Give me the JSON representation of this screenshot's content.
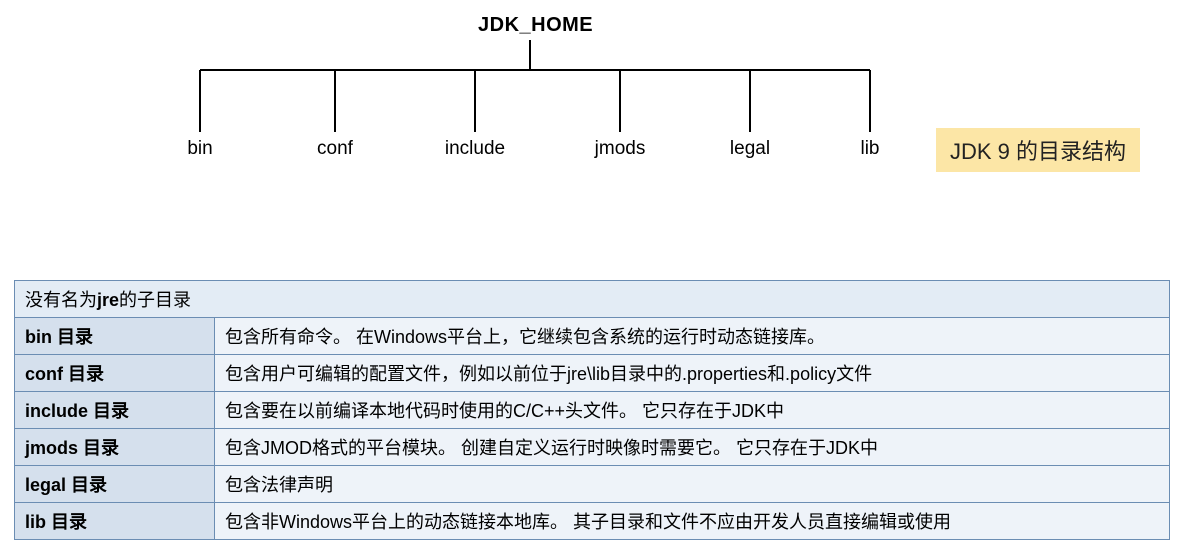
{
  "tree": {
    "root": "JDK_HOME",
    "children": [
      "bin",
      "conf",
      "include",
      "jmods",
      "legal",
      "lib"
    ]
  },
  "title": "JDK 9 的目录结构",
  "table": {
    "header": "没有名为jre的子目录",
    "rows": [
      {
        "dir": "bin 目录",
        "desc": "包含所有命令。 在Windows平台上，它继续包含系统的运行时动态链接库。"
      },
      {
        "dir": "conf 目录",
        "desc": "包含用户可编辑的配置文件，例如以前位于jre\\lib目录中的.properties和.policy文件"
      },
      {
        "dir": "include 目录",
        "desc": "包含要在以前编译本地代码时使用的C/C++头文件。 它只存在于JDK中"
      },
      {
        "dir": "jmods 目录",
        "desc": "包含JMOD格式的平台模块。 创建自定义运行时映像时需要它。 它只存在于JDK中"
      },
      {
        "dir": "legal 目录",
        "desc": "包含法律声明"
      },
      {
        "dir": "lib 目录",
        "desc": "包含非Windows平台上的动态链接本地库。 其子目录和文件不应由开发人员直接编辑或使用"
      }
    ]
  },
  "chart_data": {
    "type": "tree",
    "root": "JDK_HOME",
    "children": [
      "bin",
      "conf",
      "include",
      "jmods",
      "legal",
      "lib"
    ]
  }
}
